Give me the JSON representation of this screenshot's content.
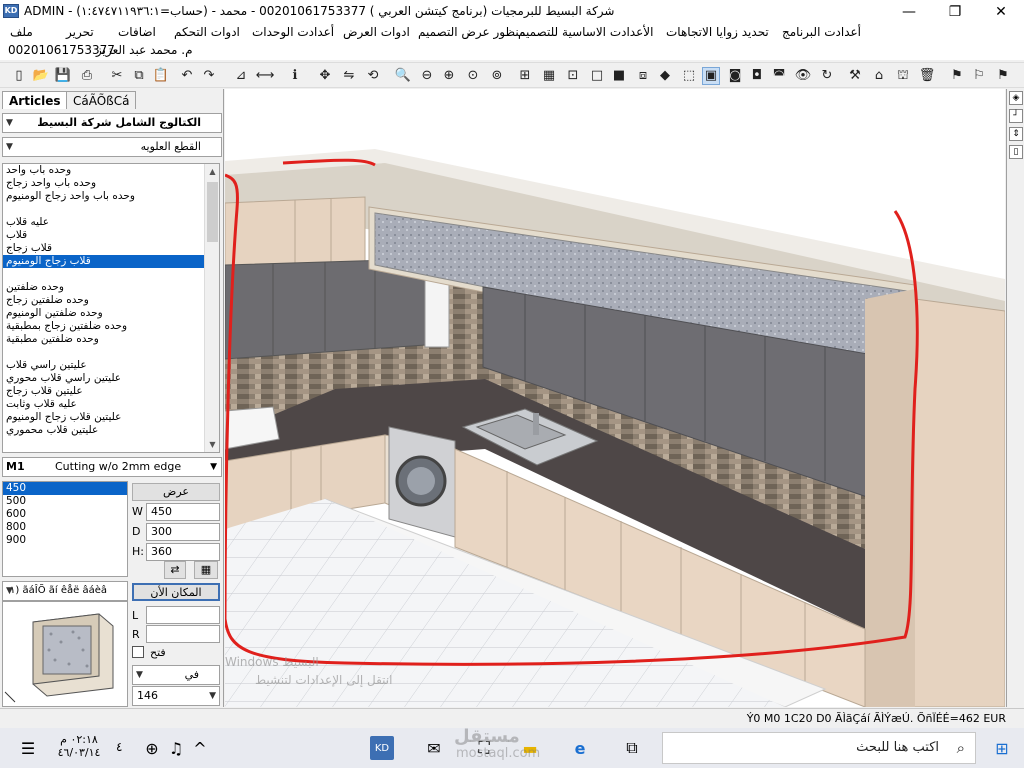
{
  "window": {
    "title": "ADMIN - شركة البسيط للبرمجيات (برنامج كيتشن العربي ) 00201061753377 - محمد - (حساب=١:٤٧٤٧١١٩٣٦:١) ",
    "minimize": "—",
    "maximize": "❐",
    "close": "✕"
  },
  "menu": {
    "items": [
      "أعدادت البرنامج",
      "تحديد زوايا الاتجاهات",
      "الأعدادت الاساسية للتصميم",
      "منظور عرض التصميم",
      "ادوات العرض",
      "أعدادت الوحدات",
      "ادوات التحكم",
      "اضافات",
      "تحرير",
      "ملف"
    ]
  },
  "user": {
    "name": "م. محمد عبد العزيز",
    "phone": "00201061753377"
  },
  "toolbar": {
    "icons": [
      "new-icon",
      "open-icon",
      "save-icon",
      "print-icon",
      "cut-icon",
      "copy-icon",
      "paste-icon",
      "undo-icon",
      "redo-icon",
      "place-icon",
      "measure-icon",
      "info-icon",
      "move-icon",
      "mirror-icon",
      "rotate-icon",
      "zoom-in-icon",
      "zoom-out-icon",
      "zoom-fit-icon",
      "zoom-window-icon",
      "zoom-all-icon",
      "grid-icon",
      "snap-icon",
      "box-icon",
      "fill-icon",
      "wire-icon",
      "cube-icon",
      "cube-solid-icon",
      "render-icon",
      "camera-icon",
      "camera2-icon",
      "eye-icon",
      "refresh-icon",
      "tools-icon",
      "paint-icon",
      "house-icon",
      "delete-icon",
      "flag-icon",
      "flag2-icon",
      "flag3-icon"
    ]
  },
  "left_panel": {
    "tabs": [
      "Articles",
      "CáÃÕßCá"
    ],
    "catalog_combo": "الكتالوج الشامل شركة البسيط",
    "category_combo": "القطع العلويه",
    "articles": [
      {
        "label": "وحده باب واحد",
        "selected": false
      },
      {
        "label": "وحده باب واحد زجاج",
        "selected": false
      },
      {
        "label": "وحده باب واحد زجاج الومنيوم",
        "selected": false
      },
      {
        "label": "",
        "selected": false
      },
      {
        "label": "عليه قلاب",
        "selected": false
      },
      {
        "label": "قلاب",
        "selected": false
      },
      {
        "label": "قلاب زجاج",
        "selected": false
      },
      {
        "label": "قلاب زجاج الومنيوم",
        "selected": true
      },
      {
        "label": "",
        "selected": false
      },
      {
        "label": "وحده ضلفتين",
        "selected": false
      },
      {
        "label": "وحده ضلفتين زجاج",
        "selected": false
      },
      {
        "label": "وحده ضلفتين الومنيوم",
        "selected": false
      },
      {
        "label": "وحده ضلفتين زجاج بمطبقية",
        "selected": false
      },
      {
        "label": "وحده ضلفتين مطبقية",
        "selected": false
      },
      {
        "label": "",
        "selected": false
      },
      {
        "label": "عليتين راسي قلاب",
        "selected": false
      },
      {
        "label": "عليتين راسي قلاب محوري",
        "selected": false
      },
      {
        "label": "عليتين قلاب زجاج",
        "selected": false
      },
      {
        "label": "عليه قلاب وثابت",
        "selected": false
      },
      {
        "label": "عليتين قلاب زجاج الومنيوم",
        "selected": false
      },
      {
        "label": "عليتين قلاب محموري",
        "selected": false
      }
    ],
    "m1_code": "M1",
    "m1_desc": "Cutting w/o 2mm edge",
    "sizes": [
      {
        "label": "450",
        "selected": true
      },
      {
        "label": "500",
        "selected": false
      },
      {
        "label": "600",
        "selected": false
      },
      {
        "label": "800",
        "selected": false
      },
      {
        "label": "900",
        "selected": false
      }
    ],
    "width_button": "عرض",
    "w_label": "W",
    "w_value": "450",
    "d_label": "D",
    "d_value": "300",
    "h_label": "H:",
    "h_value": "360",
    "option_combo": "ãáÎÕ ãí êåë âáèâ (١",
    "place_now_button": "المكان الأن",
    "l_label": "L",
    "r_label": "R",
    "open_checkbox_label": "فتح",
    "side_combo": "في",
    "count_combo": "146"
  },
  "viewport": {
    "watermark_line1": "Windows البسيط",
    "watermark_line2": "انتقل إلى الإعدادات لتنشيط"
  },
  "status": {
    "text": "Ý0 M0 1C20 D0 ÃÌãÇáí ÃÌÝæÚ. ÕñÏÉÉ=462 EUR"
  },
  "taskbar": {
    "time": "٠٢:١٨ م",
    "date": "٤٦/٠٣/١٤",
    "lang_num": "٤",
    "search_placeholder": "اكتب هنا للبحث",
    "site_watermark": "mostaql.com",
    "site_watermark_ar": "مستقل"
  }
}
